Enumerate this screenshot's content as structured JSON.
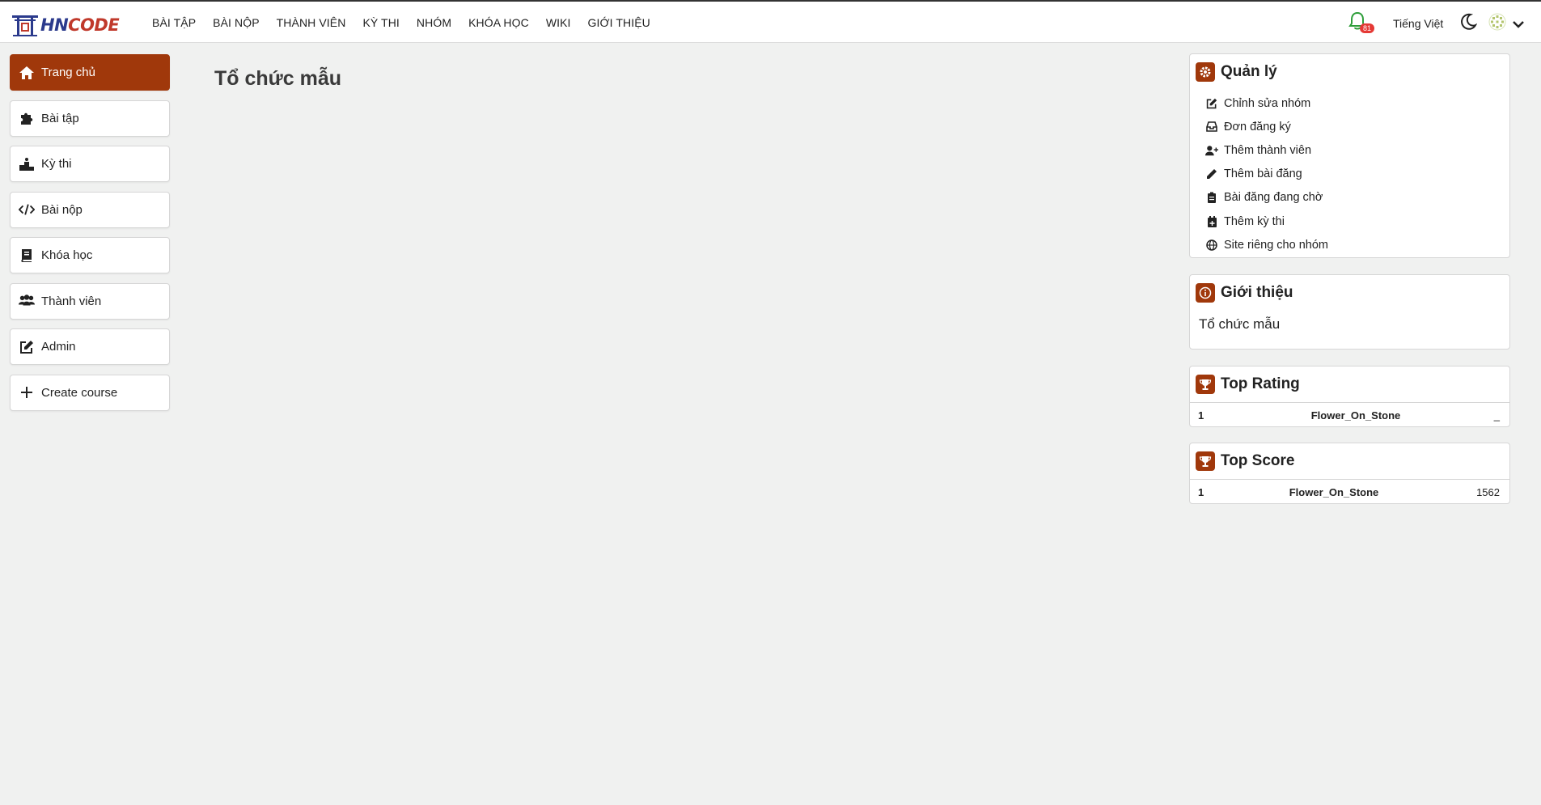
{
  "brand": {
    "logo_text_main": "HN",
    "logo_text_accent": "CODE",
    "logo_icon": "temple-gate-icon"
  },
  "nav": {
    "items": [
      "BÀI TẬP",
      "BÀI NỘP",
      "THÀNH VIÊN",
      "KỲ THI",
      "NHÓM",
      "KHÓA HỌC",
      "WIKI",
      "GIỚI THIỆU"
    ]
  },
  "header_right": {
    "notification_count": "81",
    "language": "Tiếng Việt",
    "icons": [
      "bell-icon",
      "moon-icon",
      "avatar-icon",
      "chevron-down-icon"
    ]
  },
  "sidebar": {
    "items": [
      {
        "label": "Trang chủ",
        "icon": "home-icon",
        "active": true
      },
      {
        "label": "Bài tập",
        "icon": "puzzle-icon"
      },
      {
        "label": "Kỳ thi",
        "icon": "podium-icon"
      },
      {
        "label": "Bài nộp",
        "icon": "code-icon"
      },
      {
        "label": "Khóa học",
        "icon": "book-icon"
      },
      {
        "label": "Thành viên",
        "icon": "users-icon"
      },
      {
        "label": "Admin",
        "icon": "edit-icon"
      },
      {
        "label": "Create course",
        "icon": "plus-icon"
      }
    ]
  },
  "main": {
    "title": "Tổ chức mẫu"
  },
  "manage": {
    "title": "Quản lý",
    "items": [
      {
        "label": "Chỉnh sửa nhóm",
        "icon": "edit-icon"
      },
      {
        "label": "Đơn đăng ký",
        "icon": "inbox-icon"
      },
      {
        "label": "Thêm thành viên",
        "icon": "user-plus-icon"
      },
      {
        "label": "Thêm bài đăng",
        "icon": "pencil-icon"
      },
      {
        "label": "Bài đăng đang chờ",
        "icon": "clipboard-icon"
      },
      {
        "label": "Thêm kỳ thi",
        "icon": "calendar-plus-icon"
      },
      {
        "label": "Site riêng cho nhóm",
        "icon": "globe-icon"
      }
    ]
  },
  "about": {
    "title": "Giới thiệu",
    "text": "Tổ chức mẫu"
  },
  "top_rating": {
    "title": "Top Rating",
    "rows": [
      {
        "rank": "1",
        "name": "Flower_On_Stone",
        "value": "_"
      }
    ]
  },
  "top_score": {
    "title": "Top Score",
    "rows": [
      {
        "rank": "1",
        "name": "Flower_On_Stone",
        "value": "1562"
      }
    ]
  },
  "colors": {
    "accent": "#a0380b",
    "logo_blue": "#2b3a8c",
    "logo_red": "#c0392b",
    "badge": "#e53935",
    "bell": "#2e9e3a"
  }
}
